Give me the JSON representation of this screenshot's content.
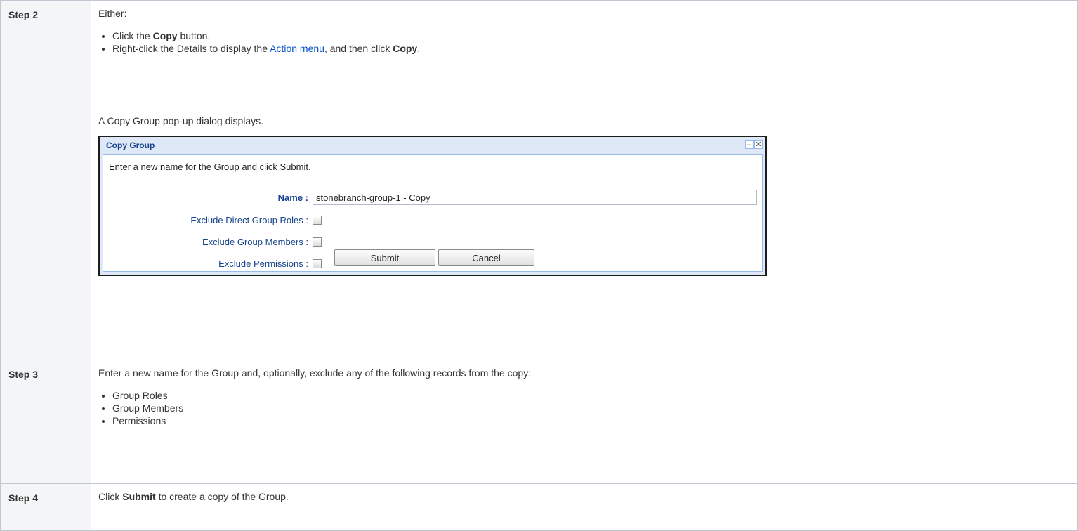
{
  "steps": [
    {
      "label": "Step 2",
      "intro": "Either:",
      "bullets": {
        "b1_pre": "Click the ",
        "b1_bold": "Copy",
        "b1_post": " button.",
        "b2_pre": "Right-click the Details to display the ",
        "b2_link": "Action menu",
        "b2_mid": ", and then click ",
        "b2_bold": "Copy",
        "b2_post": "."
      },
      "result": "A Copy Group pop-up dialog displays."
    },
    {
      "label": "Step 3",
      "intro": "Enter a new name for the Group and, optionally, exclude any of the following records from the copy:",
      "items": [
        "Group Roles",
        "Group Members",
        "Permissions"
      ]
    },
    {
      "label": "Step 4",
      "pre": "Click ",
      "bold": "Submit",
      "post": " to create a copy of the Group."
    }
  ],
  "dialog": {
    "title": "Copy Group",
    "message": "Enter a new name for the Group and click Submit.",
    "name_label": "Name :",
    "name_value": "stonebranch-group-1 - Copy",
    "options": [
      {
        "label": "Exclude Direct Group Roles :",
        "checked": false
      },
      {
        "label": "Exclude Group Members :",
        "checked": false
      },
      {
        "label": "Exclude Permissions :",
        "checked": false
      }
    ],
    "submit_label": "Submit",
    "cancel_label": "Cancel",
    "minimize_glyph": "–",
    "close_glyph": "✕"
  },
  "colors": {
    "link": "#0052cc",
    "dialog_label": "#15428b",
    "dialog_frame": "#dfe8f6"
  }
}
